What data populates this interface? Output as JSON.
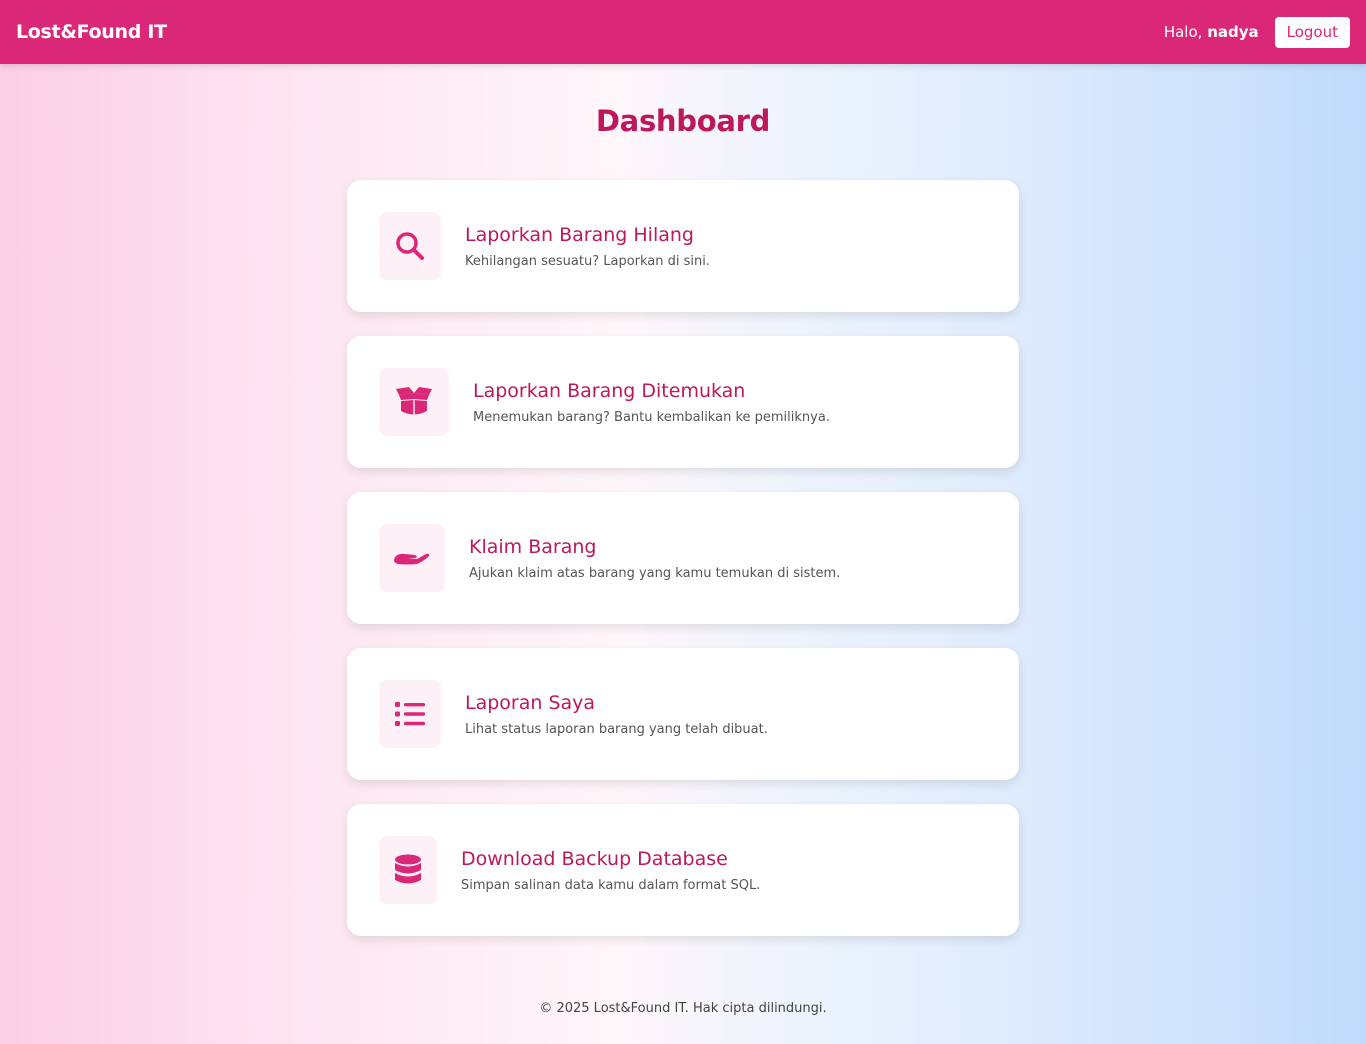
{
  "navbar": {
    "brand": "Lost&Found IT",
    "greeting_prefix": "Halo, ",
    "username": "nadya",
    "logout_label": "Logout"
  },
  "page_title": "Dashboard",
  "cards": [
    {
      "icon": "search-icon",
      "title": "Laporkan Barang Hilang",
      "description": "Kehilangan sesuatu? Laporkan di sini."
    },
    {
      "icon": "box-open-icon",
      "title": "Laporkan Barang Ditemukan",
      "description": "Menemukan barang? Bantu kembalikan ke pemiliknya."
    },
    {
      "icon": "hand-icon",
      "title": "Klaim Barang",
      "description": "Ajukan klaim atas barang yang kamu temukan di sistem."
    },
    {
      "icon": "list-icon",
      "title": "Laporan Saya",
      "description": "Lihat status laporan barang yang telah dibuat."
    },
    {
      "icon": "database-icon",
      "title": "Download Backup Database",
      "description": "Simpan salinan data kamu dalam format SQL."
    }
  ],
  "footer": "© 2025 Lost&Found IT. Hak cipta dilindungi.",
  "colors": {
    "primary": "#db2777",
    "title": "#be185d",
    "icon_bg": "#fdf0f6"
  }
}
